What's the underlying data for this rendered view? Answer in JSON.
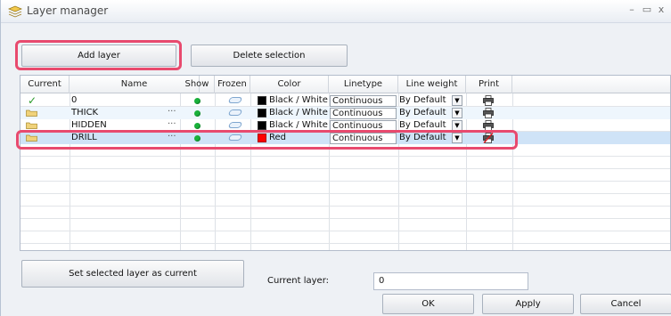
{
  "window": {
    "title": "Layer manager",
    "minimize": "–",
    "maximize": "▭",
    "close": "x"
  },
  "toolbar": {
    "add_layer": "Add layer",
    "delete_selection": "Delete selection"
  },
  "columns": [
    "Current",
    "Name",
    "Show",
    "Frozen",
    "Color",
    "Linetype",
    "Line weight",
    "Print"
  ],
  "layers": [
    {
      "current": true,
      "name": "0",
      "dots": "",
      "color_hex": "#000000",
      "color": "Black / White",
      "linetype": "Continuous",
      "lineweight": "By Default",
      "highlighted": false
    },
    {
      "current": false,
      "name": "THICK",
      "dots": "···",
      "color_hex": "#000000",
      "color": "Black / White",
      "linetype": "Continuous",
      "lineweight": "By Default",
      "highlighted": false
    },
    {
      "current": false,
      "name": "HIDDEN",
      "dots": "···",
      "color_hex": "#000000",
      "color": "Black / White",
      "linetype": "Continuous",
      "lineweight": "By Default",
      "highlighted": false
    },
    {
      "current": false,
      "name": "DRILL",
      "dots": "···",
      "color_hex": "#ff0000",
      "color": "Red",
      "linetype": "Continuous",
      "lineweight": "By Default",
      "highlighted": true
    }
  ],
  "footer": {
    "set_current": "Set selected layer as current",
    "current_layer_label": "Current layer:",
    "current_layer_value": "0",
    "ok": "OK",
    "apply": "Apply",
    "cancel": "Cancel"
  },
  "colors": {
    "highlight": "#e84a6e",
    "show_on": "#19b13a",
    "check": "#2a9a2a"
  }
}
